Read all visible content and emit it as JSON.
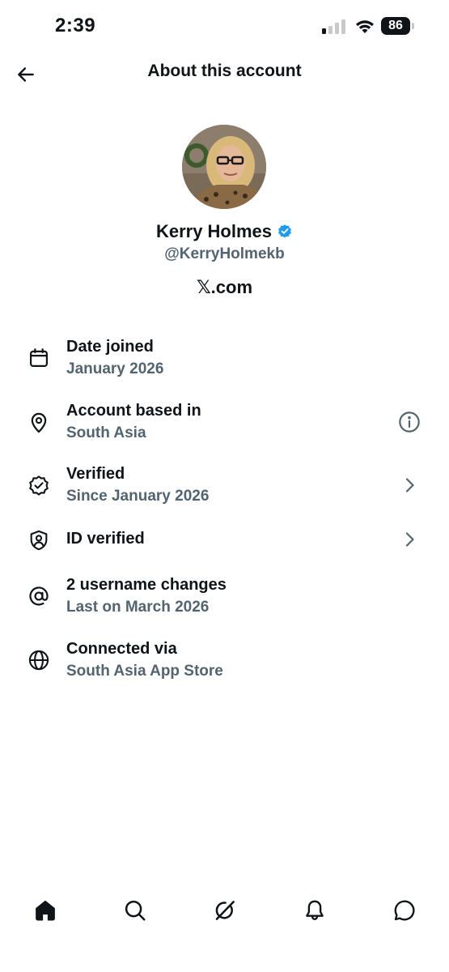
{
  "status_bar": {
    "time": "2:39",
    "battery_level": "86",
    "icons": [
      "cellular-signal-icon",
      "wifi-icon",
      "battery-icon"
    ]
  },
  "header": {
    "title": "About this account",
    "back_icon": "back-arrow-icon"
  },
  "profile": {
    "name": "Kerry Holmes",
    "handle": "@KerryHolmekb",
    "site": "𝕏.com",
    "verified_badge": "verified-badge-icon",
    "avatar": "profile-photo"
  },
  "info_items": [
    {
      "icon": "calendar-icon",
      "title": "Date joined",
      "subtitle": "January 2026",
      "trailing": ""
    },
    {
      "icon": "location-pin-icon",
      "title": "Account based in",
      "subtitle": "South Asia",
      "trailing": "info-icon"
    },
    {
      "icon": "verified-seal-icon",
      "title": "Verified",
      "subtitle": "Since January 2026",
      "trailing": "chevron-right-icon"
    },
    {
      "icon": "shield-person-icon",
      "title": "ID verified",
      "subtitle": "",
      "trailing": "chevron-right-icon"
    },
    {
      "icon": "at-sign-icon",
      "title": "2 username changes",
      "subtitle": "Last on March 2026",
      "trailing": ""
    },
    {
      "icon": "globe-icon",
      "title": "Connected via",
      "subtitle": "South Asia App Store",
      "trailing": ""
    }
  ],
  "bottom_nav": {
    "items": [
      "home-icon",
      "search-icon",
      "grok-icon",
      "notifications-icon",
      "messages-icon"
    ]
  },
  "colors": {
    "text_primary": "#0f1419",
    "text_secondary": "#536471",
    "verified_blue": "#1d9bf0",
    "background": "#ffffff"
  }
}
